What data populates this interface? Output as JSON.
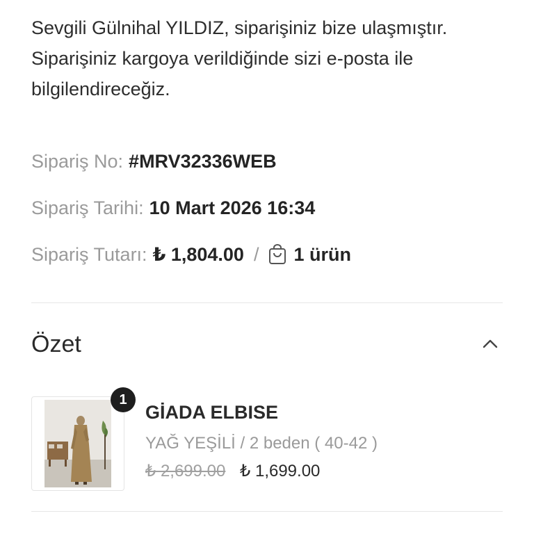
{
  "message": "Sevgili Gülnihal YILDIZ, siparişiniz bize ulaşmıştır. Siparişiniz kargoya verildiğinde sizi e-posta ile bilgilendireceğiz.",
  "order": {
    "number_label": "Sipariş No:",
    "number_value": "#MRV32336WEB",
    "date_label": "Sipariş Tarihi:",
    "date_value": "10 Mart 2026 16:34",
    "total_label": "Sipariş Tutarı:",
    "total_value": "₺ 1,804.00",
    "separator": "/",
    "item_count": "1 ürün"
  },
  "summary": {
    "title": "Özet",
    "expanded": true
  },
  "products": [
    {
      "quantity": "1",
      "name": "GİADA ELBISE",
      "variant": "YAĞ YEŞİLİ / 2 beden ( 40-42 )",
      "old_price": "₺ 2,699.00",
      "new_price": "₺ 1,699.00"
    }
  ],
  "icons": {
    "bag": "shopping-bag-icon",
    "chevron": "chevron-up-icon"
  },
  "colors": {
    "text": "#2a2a2a",
    "muted": "#9a9a9a",
    "badge": "#1e1e1e",
    "divider": "#e6e6e6"
  }
}
